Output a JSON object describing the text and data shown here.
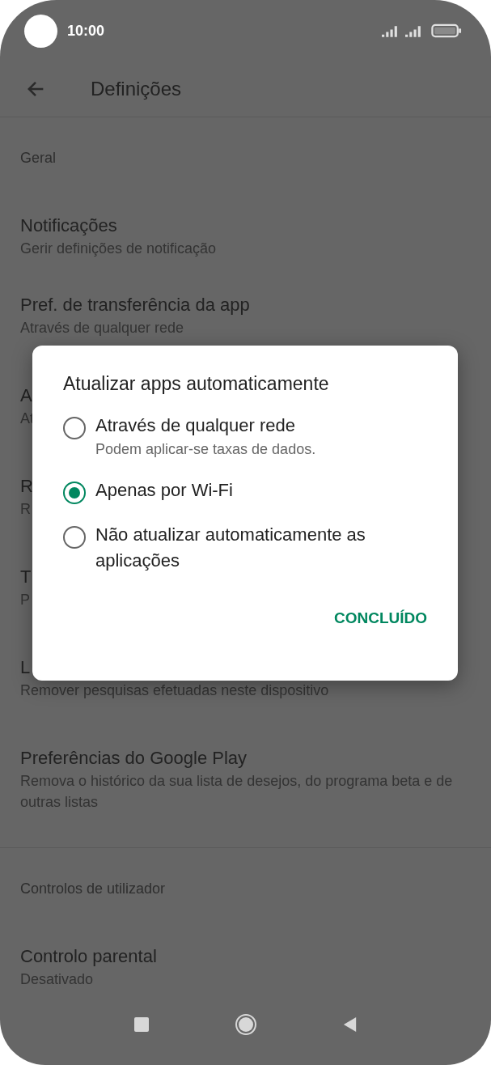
{
  "status_bar": {
    "time": "10:00"
  },
  "app_bar": {
    "title": "Definições"
  },
  "sections": [
    {
      "header": "Geral",
      "items": [
        {
          "title": "Notificações",
          "subtitle": "Gerir definições de notificação"
        },
        {
          "title": "Pref. de transferência da app",
          "subtitle": "Através de qualquer rede"
        },
        {
          "title": "A",
          "subtitle": "At"
        },
        {
          "title": "R",
          "subtitle": "R"
        },
        {
          "title": "T",
          "subtitle": "P"
        },
        {
          "title": "L",
          "subtitle": "Remover pesquisas efetuadas neste dispositivo"
        },
        {
          "title": "Preferências do Google Play",
          "subtitle": "Remova o histórico da sua lista de desejos, do programa beta e de outras listas"
        }
      ]
    },
    {
      "header": "Controlos de utilizador",
      "items": [
        {
          "title": "Controlo parental",
          "subtitle": "Desativado"
        }
      ]
    }
  ],
  "dialog": {
    "title": "Atualizar apps automaticamente",
    "options": [
      {
        "label": "Através de qualquer rede",
        "subtitle": "Podem aplicar-se taxas de dados.",
        "selected": false
      },
      {
        "label": "Apenas por Wi-Fi",
        "selected": true
      },
      {
        "label": "Não atualizar automaticamente as aplicações",
        "selected": false
      }
    ],
    "button": "CONCLUÍDO"
  }
}
